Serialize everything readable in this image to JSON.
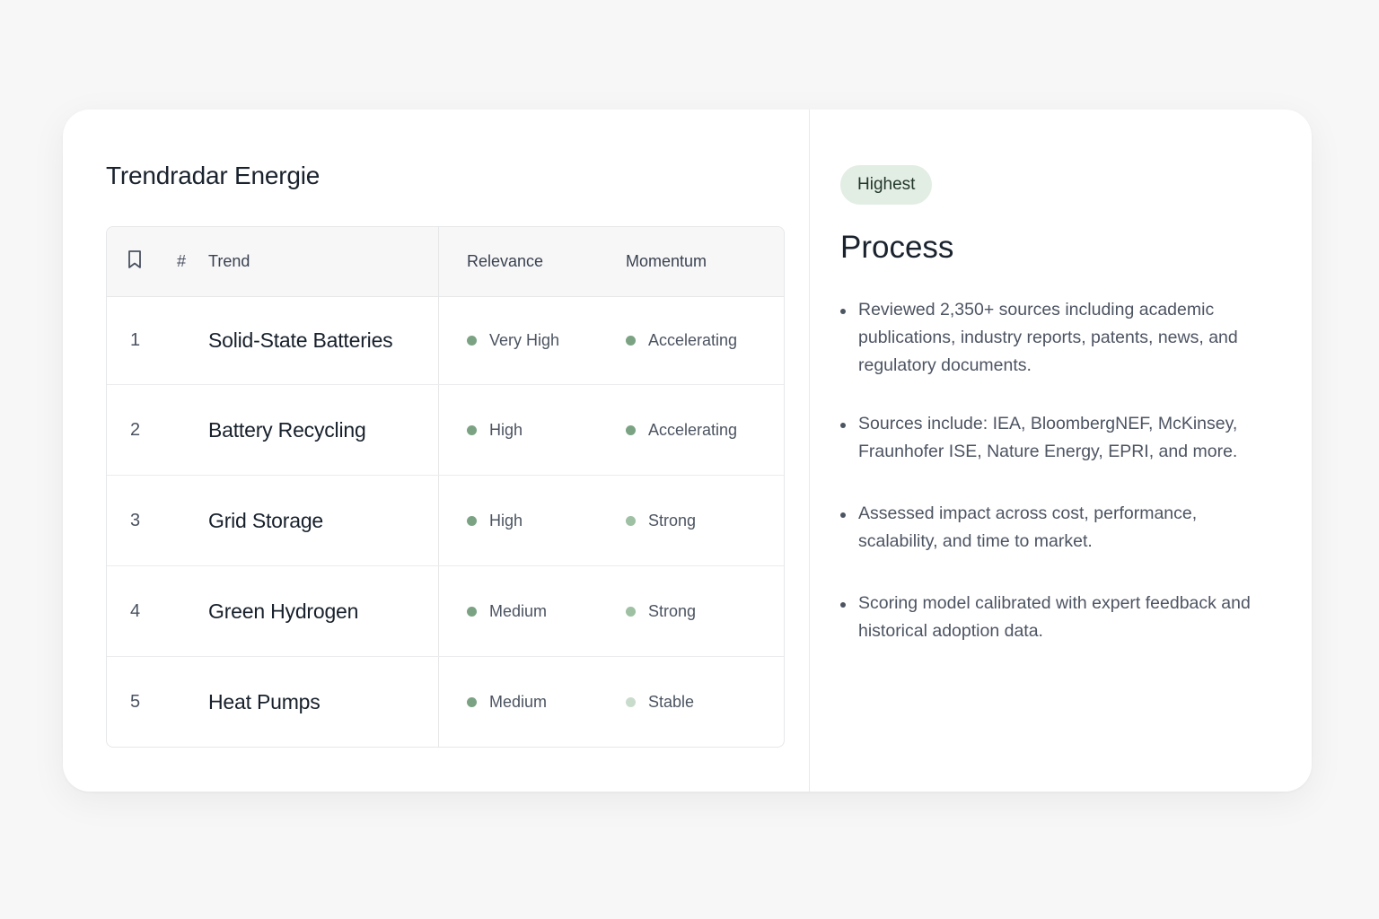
{
  "panel": {
    "title": "Trendradar Energie"
  },
  "table": {
    "headers": {
      "bookmark_icon": "bookmark-icon",
      "number": "#",
      "trend": "Trend",
      "relevance": "Relevance",
      "momentum": "Momentum"
    },
    "rows": [
      {
        "rank": "1",
        "trend": "Solid-State Batteries",
        "relevance": "Very High",
        "momentum": "Accelerating",
        "relevance_color": "#7ba383",
        "momentum_color": "#7ba383"
      },
      {
        "rank": "2",
        "trend": "Battery Recycling",
        "relevance": "High",
        "momentum": "Accelerating",
        "relevance_color": "#7ba383",
        "momentum_color": "#7ba383"
      },
      {
        "rank": "3",
        "trend": "Grid Storage",
        "relevance": "High",
        "momentum": "Strong",
        "relevance_color": "#7ba383",
        "momentum_color": "#9ec0a3"
      },
      {
        "rank": "4",
        "trend": "Green Hydrogen",
        "relevance": "Medium",
        "momentum": "Strong",
        "relevance_color": "#7ba383",
        "momentum_color": "#9ec0a3"
      },
      {
        "rank": "5",
        "trend": "Heat Pumps",
        "relevance": "Medium",
        "momentum": "Stable",
        "relevance_color": "#7ba383",
        "momentum_color": "#c9dccb"
      }
    ]
  },
  "process": {
    "badge": "Highest",
    "title": "Process",
    "bullets": [
      "Reviewed 2,350+ sources including academic publications, industry reports, patents, news, and regulatory documents.",
      "Sources include: IEA, BloombergNEF, McKinsey, Fraunhofer ISE, Nature Energy, EPRI, and more.",
      "Assessed impact across cost, performance, scalability, and time to market.",
      "Scoring model calibrated with expert feedback and historical adoption data."
    ]
  },
  "colors": {
    "accent_green": "#7ba383",
    "badge_bg": "#e2ede4"
  }
}
